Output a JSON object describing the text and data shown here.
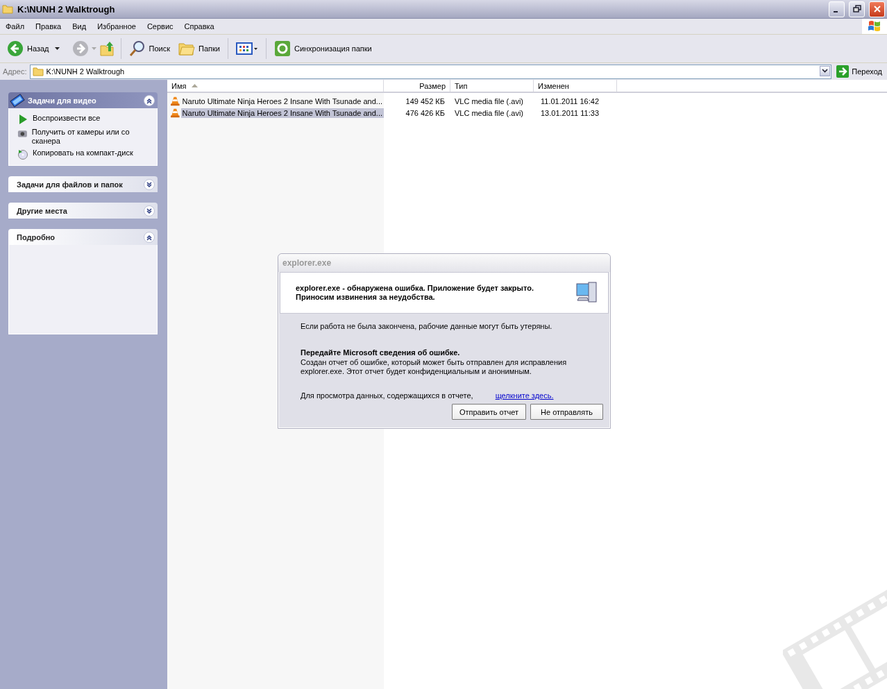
{
  "window": {
    "title": "K:\\NUNH 2 Walktrough"
  },
  "menu": [
    "Файл",
    "Правка",
    "Вид",
    "Избранное",
    "Сервис",
    "Справка"
  ],
  "toolbar": {
    "back": "Назад",
    "search": "Поиск",
    "folders": "Папки",
    "sync": "Синхронизация папки"
  },
  "address": {
    "label": "Адрес:",
    "value": "K:\\NUNH 2 Walktrough",
    "go": "Переход"
  },
  "sidebar": {
    "panels": [
      {
        "title": "Задачи для видео",
        "expanded": true,
        "kind": "special",
        "items": [
          {
            "label": "Воспроизвести все",
            "kind": "play"
          },
          {
            "label": "Получить от камеры или со сканера",
            "kind": "camera"
          },
          {
            "label": "Копировать на компакт-диск",
            "kind": "disc"
          }
        ]
      },
      {
        "title": "Задачи для файлов и папок",
        "expanded": false,
        "kind": "normal"
      },
      {
        "title": "Другие места",
        "expanded": false,
        "kind": "normal"
      },
      {
        "title": "Подробно",
        "expanded": true,
        "kind": "normal"
      }
    ]
  },
  "table": {
    "columns": [
      "Имя",
      "Размер",
      "Тип",
      "Изменен"
    ],
    "rows": [
      {
        "name": "Naruto Ultimate Ninja Heroes 2 Insane With Tsunade and...",
        "size": "149 452 КБ",
        "type": "VLC media file (.avi)",
        "modified": "11.01.2011 16:42",
        "selected": false
      },
      {
        "name": "Naruto Ultimate Ninja Heroes 2 Insane With Tsunade and...",
        "size": "476 426 КБ",
        "type": "VLC media file (.avi)",
        "modified": "13.01.2011 11:33",
        "selected": true
      }
    ]
  },
  "dialog": {
    "title": "explorer.exe",
    "heading": "explorer.exe - обнаружена ошибка. Приложение будет закрыто. Приносим извинения за неудобства.",
    "warning": "Если работа не была закончена, рабочие данные могут быть утеряны.",
    "subheading": "Передайте Microsoft сведения об ошибке.",
    "body": "Создан отчет об ошибке, который может быть отправлен для исправления explorer.exe. Этот отчет будет конфиденциальным и анонимным.",
    "details_text": "Для просмотра данных, содержащихся в отчете,",
    "details_link": "щелкните здесь.",
    "buttons": [
      "Отправить отчет",
      "Не отправлять"
    ]
  }
}
